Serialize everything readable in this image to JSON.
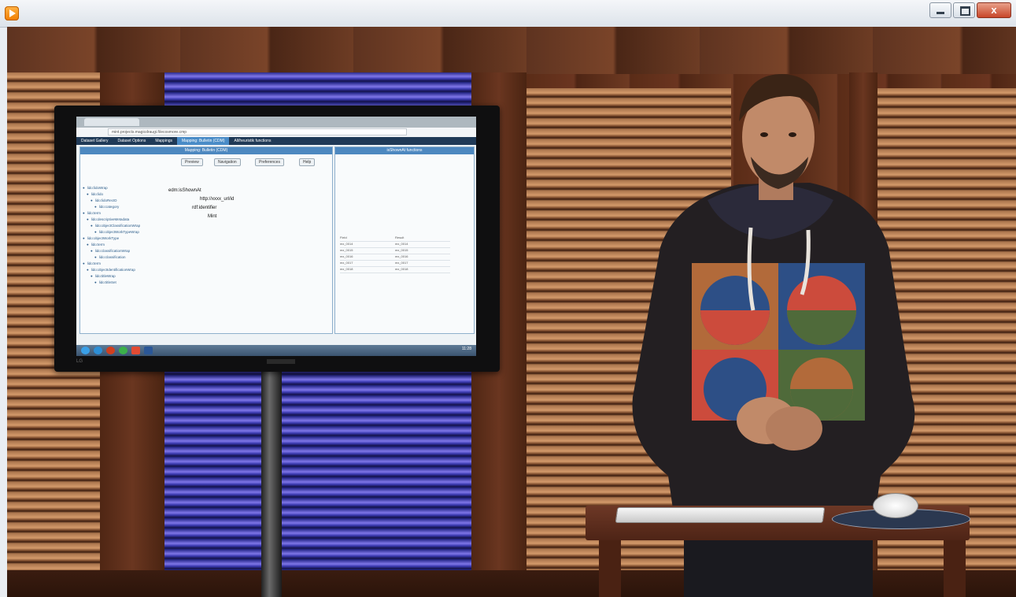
{
  "window": {
    "title": "",
    "buttons": {
      "minimize": "",
      "maximize": "",
      "close": "x"
    }
  },
  "screen": {
    "browser_url": "mint.projects.magicdraugi.fi/ecosmore.cmp",
    "menu": [
      "Dataset Gallery",
      "Dataset Options",
      "Mappings",
      "Mapping: Bulletin (CDM)",
      "All/heuristik functions"
    ],
    "active_menu_index": 3,
    "editor_title": "Mapping: Bulletin (CDM)",
    "toolbar": [
      "Preview",
      "Navigation",
      "Preferences",
      "Help"
    ],
    "tree_items": [
      "lido:lidoWrap",
      "lido:lido",
      "lido:lidoRecID",
      "lido:category",
      "lido:term",
      "lido:descriptiveMetadata",
      "lido:objectClassificationWrap",
      "lido:objectWorkTypeWrap",
      "lido:objectWorkType",
      "lido:term",
      "lido:classificationWrap",
      "lido:classification",
      "lido:term",
      "lido:objectIdentificationWrap",
      "lido:titleWrap",
      "lido:titleSet"
    ],
    "canvas_nodes": [
      "edm:isShownAt",
      "http://xxxx_url/id",
      "rdf:identifier",
      "Mint"
    ],
    "side_panel_title": "isShownAt functions",
    "side_table_headers": [
      "Field",
      "Result"
    ],
    "side_table_rows": [
      [
        "mx_0014",
        "mx_0014"
      ],
      [
        "mx_0015",
        "mx_0015"
      ],
      [
        "mx_0016",
        "mx_0016"
      ],
      [
        "mx_0017",
        "mx_0017"
      ],
      [
        "mx_0018",
        "mx_0018"
      ]
    ],
    "clock": "11:28"
  },
  "tv": {
    "brand": "LG"
  },
  "colors": {
    "accent": "#f07d00",
    "close_button": "#c8472a",
    "screen_menu_bar": "#203a57",
    "screen_highlight": "#4a8cc7"
  }
}
